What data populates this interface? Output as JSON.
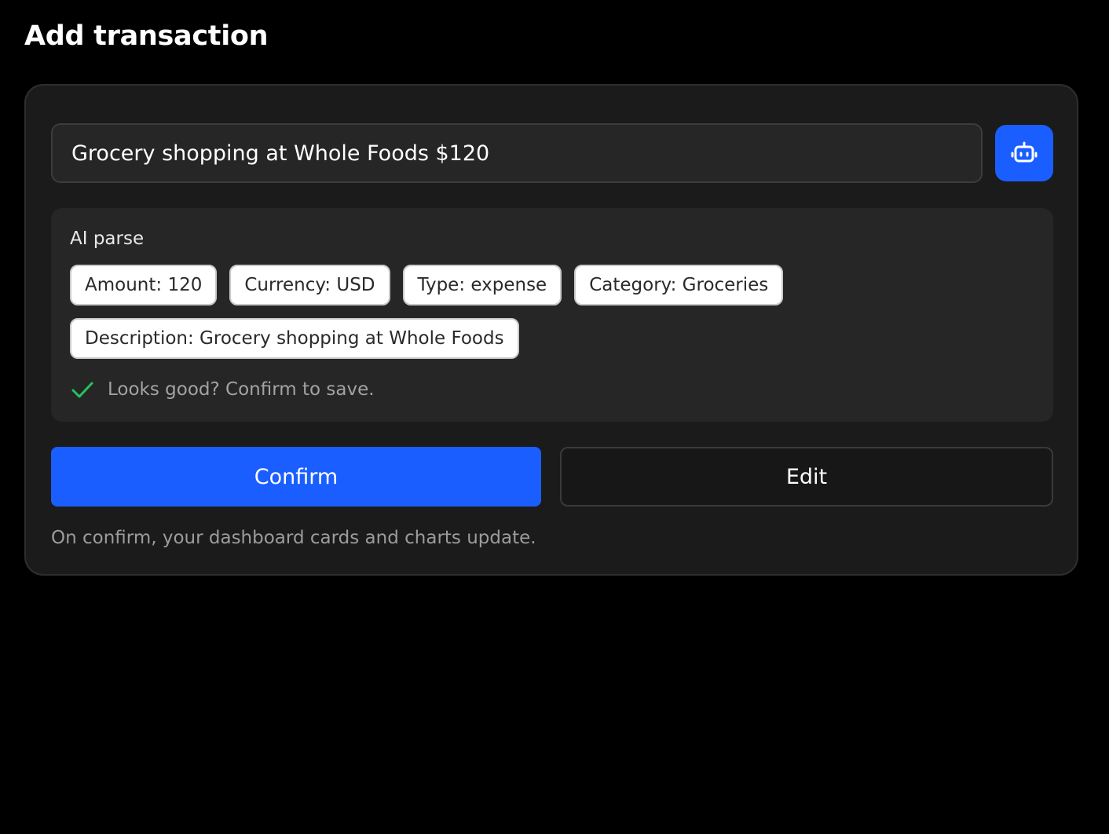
{
  "page": {
    "title": "Add transaction"
  },
  "input": {
    "value": "Grocery shopping at Whole Foods $120",
    "ai_button_icon": "robot-icon"
  },
  "parse": {
    "label": "AI parse",
    "chips": [
      "Amount: 120",
      "Currency: USD",
      "Type: expense",
      "Category: Groceries",
      "Description: Grocery shopping at Whole Foods"
    ],
    "status_icon": "check-icon",
    "status_text": "Looks good? Confirm to save."
  },
  "actions": {
    "confirm_label": "Confirm",
    "edit_label": "Edit"
  },
  "footnote": "On confirm, your dashboard cards and charts update.",
  "colors": {
    "accent": "#1a5eff",
    "success": "#22c55e",
    "background": "#000000",
    "card": "#1b1b1b",
    "panel": "#262626"
  }
}
